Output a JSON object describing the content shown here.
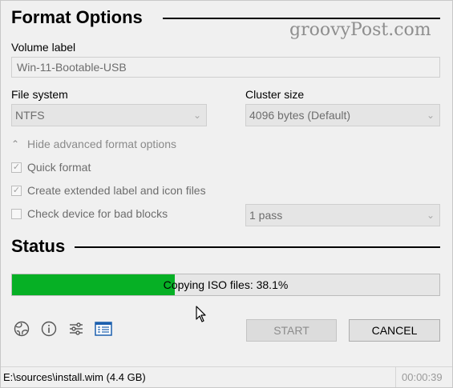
{
  "format_options": {
    "title": "Format Options",
    "watermark": "groovyPost.com",
    "volume_label": {
      "label": "Volume label",
      "value": "Win-11-Bootable-USB"
    },
    "file_system": {
      "label": "File system",
      "value": "NTFS"
    },
    "cluster_size": {
      "label": "Cluster size",
      "value": "4096 bytes (Default)"
    },
    "advanced_toggle": "Hide advanced format options",
    "quick_format": {
      "label": "Quick format",
      "checked": true
    },
    "extended_label": {
      "label": "Create extended label and icon files",
      "checked": true
    },
    "bad_blocks": {
      "label": "Check device for bad blocks",
      "checked": false,
      "passes": "1 pass"
    }
  },
  "status": {
    "title": "Status",
    "progress_text": "Copying ISO files: 38.1%",
    "progress_fraction": 0.381,
    "progress_color": "#06b025"
  },
  "buttons": {
    "start": "START",
    "cancel": "CANCEL"
  },
  "toolbar_icons": [
    "globe-icon",
    "info-icon",
    "settings-sliders-icon",
    "log-icon"
  ],
  "statusbar": {
    "path": "E:\\sources\\install.wim (4.4 GB)",
    "elapsed": "00:00:39"
  }
}
